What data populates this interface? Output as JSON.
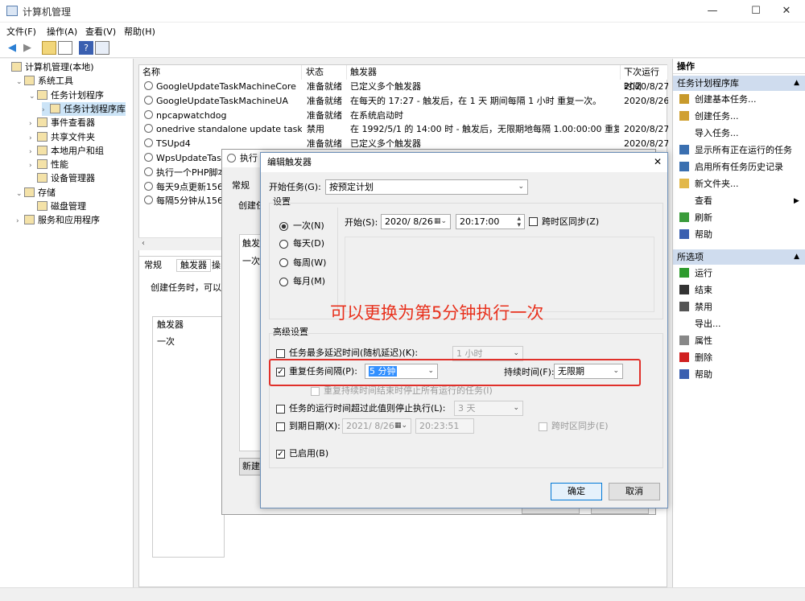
{
  "window": {
    "title": "计算机管理",
    "minimize": "—",
    "maximize": "☐",
    "close": "✕"
  },
  "menu": [
    "文件(F)",
    "操作(A)",
    "查看(V)",
    "帮助(H)"
  ],
  "toolbar_icons": [
    "back-icon",
    "forward-icon",
    "up-folder-icon",
    "view-icon",
    "help-icon",
    "properties-icon"
  ],
  "tree": {
    "items": [
      {
        "label": "计算机管理(本地)",
        "indent": 0,
        "exp": ""
      },
      {
        "label": "系统工具",
        "indent": 1,
        "exp": "⌄"
      },
      {
        "label": "任务计划程序",
        "indent": 2,
        "exp": "⌄"
      },
      {
        "label": "任务计划程序库",
        "indent": 3,
        "exp": "›",
        "selected": true
      },
      {
        "label": "事件查看器",
        "indent": 2,
        "exp": "›"
      },
      {
        "label": "共享文件夹",
        "indent": 2,
        "exp": "›"
      },
      {
        "label": "本地用户和组",
        "indent": 2,
        "exp": "›"
      },
      {
        "label": "性能",
        "indent": 2,
        "exp": "›"
      },
      {
        "label": "设备管理器",
        "indent": 2,
        "exp": ""
      },
      {
        "label": "存储",
        "indent": 1,
        "exp": "⌄"
      },
      {
        "label": "磁盘管理",
        "indent": 2,
        "exp": ""
      },
      {
        "label": "服务和应用程序",
        "indent": 1,
        "exp": "›"
      }
    ]
  },
  "tasks": {
    "columns": [
      "名称",
      "状态",
      "触发器",
      "下次运行时间"
    ],
    "rows": [
      {
        "name": "GoogleUpdateTaskMachineCore",
        "status": "准备就绪",
        "trigger": "已定义多个触发器",
        "next": "2020/8/27"
      },
      {
        "name": "GoogleUpdateTaskMachineUA",
        "status": "准备就绪",
        "trigger": "在每天的 17:27 - 触发后，在 1 天 期间每隔 1 小时 重复一次。",
        "next": "2020/8/26"
      },
      {
        "name": "npcapwatchdog",
        "status": "准备就绪",
        "trigger": "在系统启动时",
        "next": ""
      },
      {
        "name": "onedrive standalone update task-...",
        "status": "禁用",
        "trigger": "在 1992/5/1 的 14:00 时 - 触发后，无限期地每隔 1.00:00:00 重复一...",
        "next": "2020/8/27"
      },
      {
        "name": "TSUpd4",
        "status": "准备就绪",
        "trigger": "已定义多个触发器",
        "next": "2020/8/27"
      },
      {
        "name": "WpsUpdateTask",
        "status": "",
        "trigger": "",
        "next": ""
      },
      {
        "name": "执行一个PHP脚本",
        "status": "",
        "trigger": "",
        "next": ""
      },
      {
        "name": "每天9点更新156",
        "status": "",
        "trigger": "",
        "next": ""
      },
      {
        "name": "每隔5分钟从156",
        "status": "",
        "trigger": "",
        "next": ""
      }
    ]
  },
  "lower": {
    "tabs": [
      "常规",
      "触发器",
      "操"
    ],
    "desc": "创建任务时，可以指",
    "col": "触发器",
    "row": "一次"
  },
  "bgwin": {
    "title": "执行",
    "tab": "常规",
    "desc": "创建任",
    "col": "触发",
    "row": "一次",
    "new": "新建"
  },
  "actions": {
    "header": "操作",
    "section1": "任务计划程序库",
    "items1": [
      {
        "label": "创建基本任务...",
        "icon": "create-basic-task-icon",
        "color": "#c89a2c"
      },
      {
        "label": "创建任务...",
        "icon": "create-task-icon",
        "color": "#d0a030"
      },
      {
        "label": "导入任务...",
        "icon": "",
        "color": ""
      },
      {
        "label": "显示所有正在运行的任务",
        "icon": "running-tasks-icon",
        "color": "#3a6fb0"
      },
      {
        "label": "启用所有任务历史记录",
        "icon": "history-icon",
        "color": "#3a6fb0"
      },
      {
        "label": "新文件夹...",
        "icon": "new-folder-icon",
        "color": "#e2b84a"
      },
      {
        "label": "查看",
        "icon": "",
        "color": "",
        "arrow": "▶"
      },
      {
        "label": "刷新",
        "icon": "refresh-icon",
        "color": "#3a9b3a"
      },
      {
        "label": "帮助",
        "icon": "help-icon",
        "color": "#3a5fb0"
      }
    ],
    "section2": "所选项",
    "items2": [
      {
        "label": "运行",
        "icon": "run-icon",
        "color": "#2e9b2e"
      },
      {
        "label": "结束",
        "icon": "stop-icon",
        "color": "#333333"
      },
      {
        "label": "禁用",
        "icon": "disable-icon",
        "color": "#555555"
      },
      {
        "label": "导出...",
        "icon": "",
        "color": ""
      },
      {
        "label": "属性",
        "icon": "properties-icon",
        "color": "#888888"
      },
      {
        "label": "删除",
        "icon": "delete-icon",
        "color": "#d02020"
      },
      {
        "label": "帮助",
        "icon": "help-icon",
        "color": "#3a5fb0"
      }
    ]
  },
  "dialog": {
    "title": "编辑触发器",
    "begin_label": "开始任务(G):",
    "begin_value": "按预定计划",
    "settings_label": "设置",
    "radios": [
      "一次(N)",
      "每天(D)",
      "每周(W)",
      "每月(M)"
    ],
    "start_label": "开始(S):",
    "start_date": "2020/ 8/26",
    "start_time": "20:17:00",
    "sync_label": "跨时区同步(Z)",
    "annotation": "可以更换为第5分钟执行一次",
    "annotation_color": "#e8301c",
    "advanced_label": "高级设置",
    "delay_label": "任务最多延迟时间(随机延迟)(K):",
    "delay_value": "1 小时",
    "repeat_label": "重复任务间隔(P):",
    "repeat_value": "5 分钟",
    "duration_label": "持续时间(F):",
    "duration_value": "无限期",
    "stop_all_label": "重复持续时间结束时停止所有运行的任务(I)",
    "stop_if_label": "任务的运行时间超过此值则停止执行(L):",
    "stop_if_value": "3 天",
    "expire_label": "到期日期(X):",
    "expire_date": "2021/ 8/26",
    "expire_time": "20:23:51",
    "expire_sync": "跨时区同步(E)",
    "enabled_label": "已启用(B)",
    "ok": "确定",
    "cancel": "取消",
    "highlight_color": "#e0302a"
  }
}
